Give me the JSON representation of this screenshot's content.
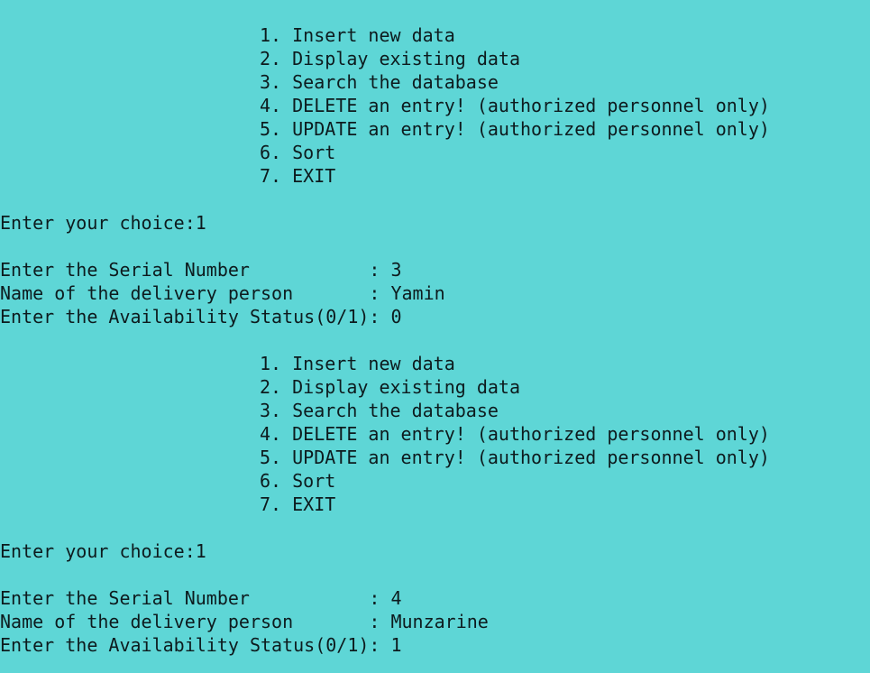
{
  "theme": {
    "background": "#5ed6d6",
    "text": "#0d1b1e"
  },
  "session": {
    "block1": {
      "menu": [
        "1. Insert new data",
        "2. Display existing data",
        "3. Search the database",
        "4. DELETE an entry! (authorized personnel only)",
        "5. UPDATE an entry! (authorized personnel only)",
        "6. Sort",
        "7. EXIT"
      ],
      "choice_prompt": "Enter your choice:1",
      "fields": [
        "Enter the Serial Number           : 3",
        "Name of the delivery person       : Yamin",
        "Enter the Availability Status(0/1): 0"
      ]
    },
    "block2": {
      "menu": [
        "1. Insert new data",
        "2. Display existing data",
        "3. Search the database",
        "4. DELETE an entry! (authorized personnel only)",
        "5. UPDATE an entry! (authorized personnel only)",
        "6. Sort",
        "7. EXIT"
      ],
      "choice_prompt": "Enter your choice:1",
      "fields": [
        "Enter the Serial Number           : 4",
        "Name of the delivery person       : Munzarine",
        "Enter the Availability Status(0/1): 1"
      ]
    }
  }
}
